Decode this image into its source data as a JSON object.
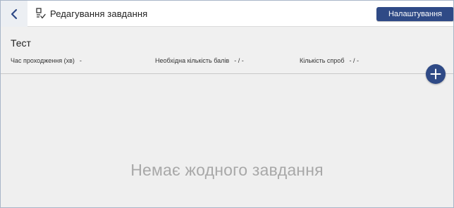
{
  "header": {
    "title": "Редагування завдання",
    "settings_label": "Налаштування",
    "back_icon": "chevron-left-icon",
    "task_icon": "task-list-icon"
  },
  "test": {
    "name": "Тест",
    "stats": [
      {
        "label": "Час проходження (хв)",
        "value": "-"
      },
      {
        "label": "Необхідна кількість балів",
        "value": "- / -"
      },
      {
        "label": "Кількість спроб",
        "value": "- / -"
      }
    ]
  },
  "actions": {
    "add_icon": "plus-icon"
  },
  "empty_state": {
    "message": "Немає жодного завдання"
  },
  "colors": {
    "accent": "#2f4a86",
    "background": "#efefef",
    "muted_text": "#a8a8a8"
  }
}
